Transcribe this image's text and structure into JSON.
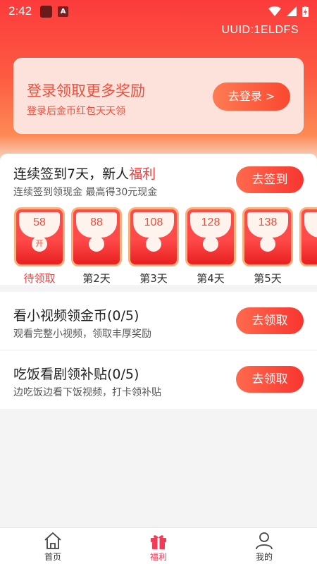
{
  "status_bar": {
    "time": "2:42",
    "app_badge": "A"
  },
  "uuid": "UUID:1ELDFS",
  "login_banner": {
    "title": "登录领取更多奖励",
    "subtitle": "登录后金币红包天天领",
    "button": "去登录 >"
  },
  "signin": {
    "title_prefix": "连续签到7天，新人",
    "title_highlight": "福利",
    "subtitle": "连续签到领现金 最高得30元现金",
    "button": "去签到",
    "days": [
      {
        "amount": "58",
        "coin": "开",
        "label": "待领取",
        "today": true
      },
      {
        "amount": "88",
        "coin": "",
        "label": "第2天",
        "today": false
      },
      {
        "amount": "108",
        "coin": "",
        "label": "第3天",
        "today": false
      },
      {
        "amount": "128",
        "coin": "",
        "label": "第4天",
        "today": false
      },
      {
        "amount": "138",
        "coin": "",
        "label": "第5天",
        "today": false
      }
    ]
  },
  "tasks": [
    {
      "title": "看小视频领金币(0/5)",
      "subtitle": "观看完整小视频，领取丰厚奖励",
      "button": "去领取"
    },
    {
      "title": "吃饭看剧领补贴(0/5)",
      "subtitle": "边吃饭边看下饭视频，打卡领补贴",
      "button": "去领取"
    }
  ],
  "tabbar": [
    {
      "label": "首页",
      "icon": "home-icon",
      "active": false
    },
    {
      "label": "福利",
      "icon": "gift-icon",
      "active": true
    },
    {
      "label": "我的",
      "icon": "user-icon",
      "active": false
    }
  ],
  "colors": {
    "accent": "#f33b3b",
    "tab_active": "#f23b56"
  }
}
